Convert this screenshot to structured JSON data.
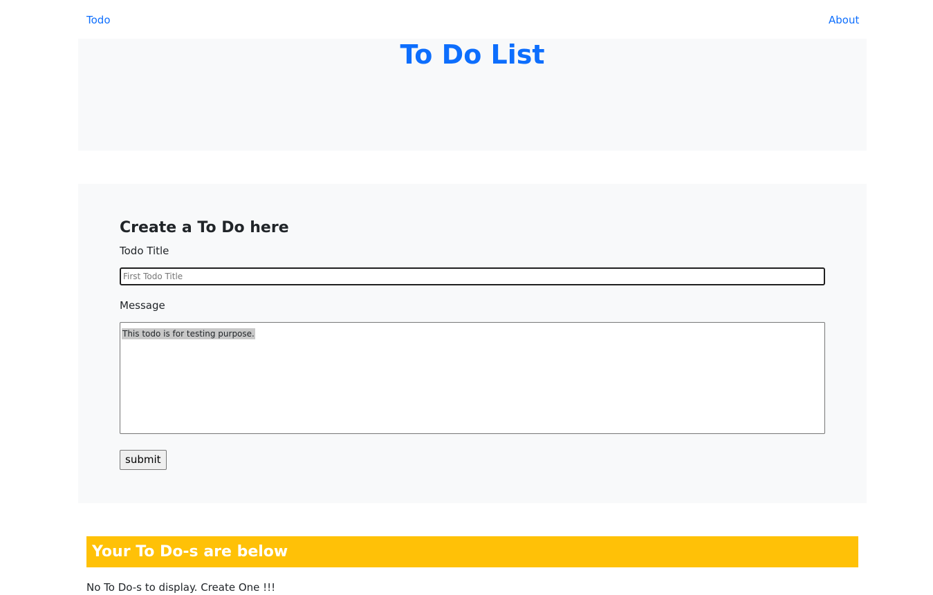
{
  "nav": {
    "brand": "Todo",
    "about": "About"
  },
  "hero": {
    "title": "To Do List"
  },
  "form": {
    "heading": "Create a To Do here",
    "title_label": "Todo Title",
    "title_placeholder": "First Todo Title",
    "title_value": "",
    "message_label": "Message",
    "message_value": "This todo is for testing purpose.",
    "submit_label": "submit"
  },
  "todos": {
    "heading": "Your To Do-s are below",
    "empty_message": "No To Do-s to display. Create One !!!"
  },
  "colors": {
    "link": "#0d6efd",
    "panel": "#f8f9fa",
    "banner": "#ffc107"
  }
}
